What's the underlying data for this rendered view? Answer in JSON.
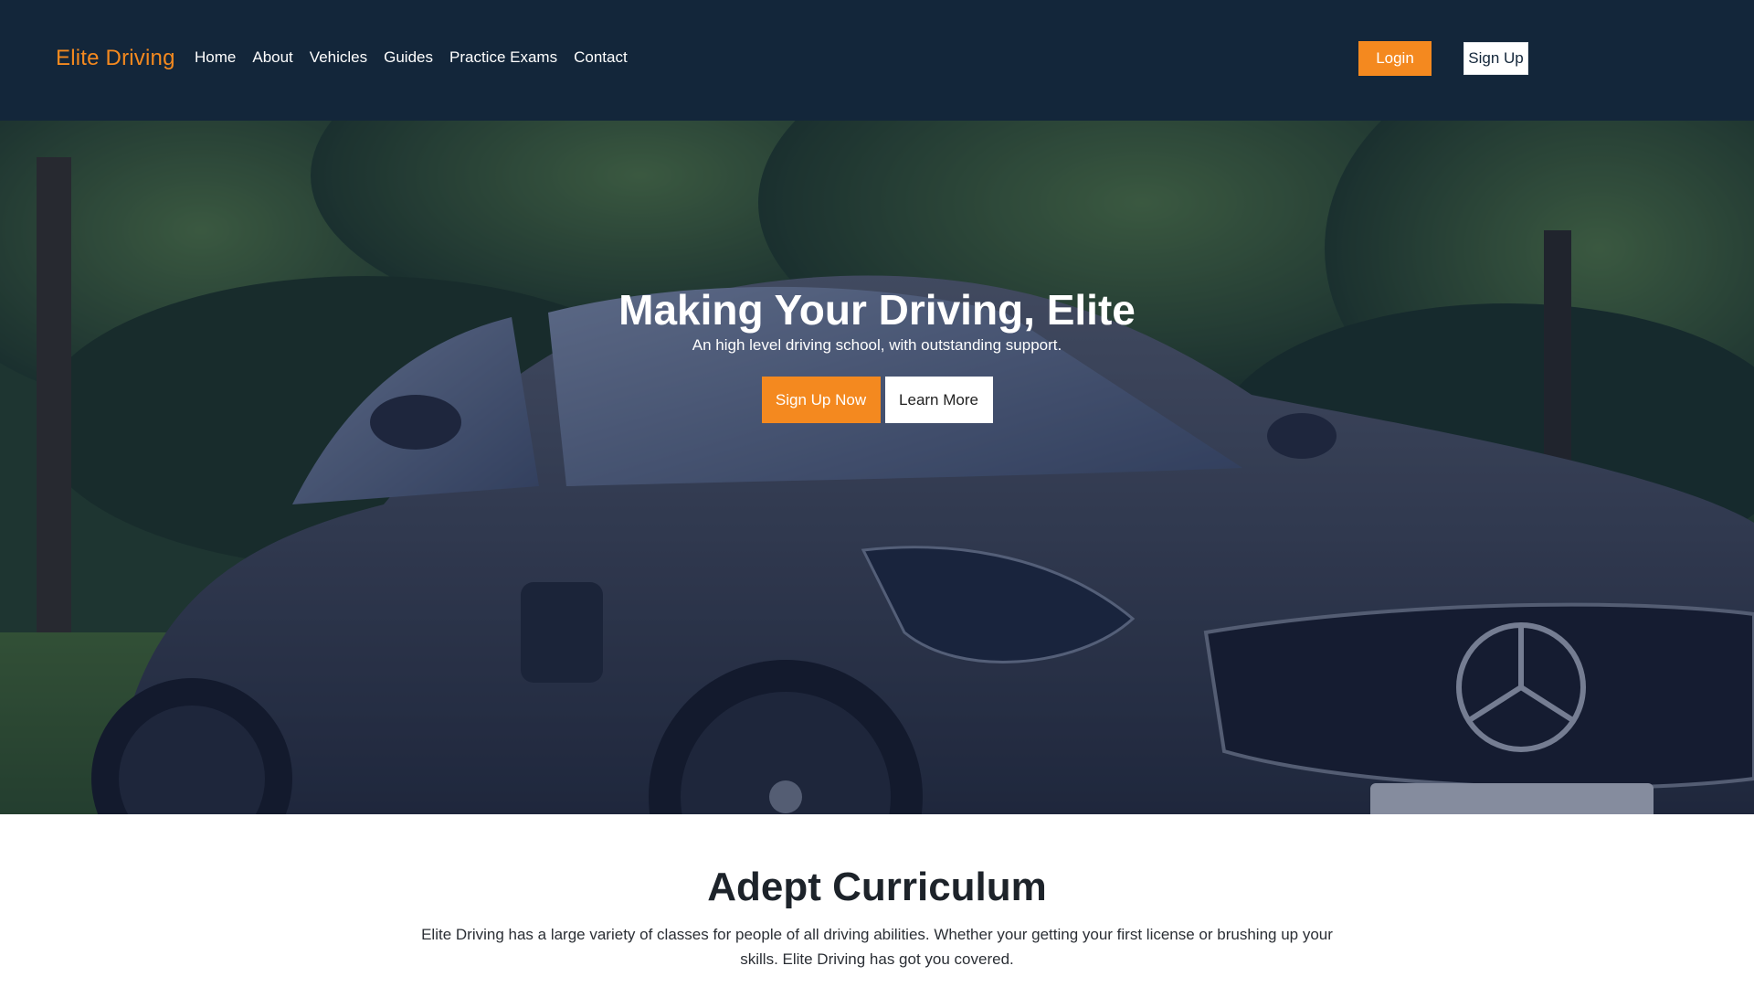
{
  "navbar": {
    "brand": "Elite Driving",
    "links": [
      "Home",
      "About",
      "Vehicles",
      "Guides",
      "Practice Exams",
      "Contact"
    ],
    "login_label": "Login",
    "signup_label": "Sign Up"
  },
  "hero": {
    "title": "Making Your Driving, Elite",
    "subtitle": "An high level driving school, with outstanding support.",
    "primary_button": "Sign Up Now",
    "secondary_button": "Learn More"
  },
  "curriculum": {
    "title": "Adept Curriculum",
    "text": "Elite Driving has a large variety of classes for people of all driving abilities. Whether your getting your first license or brushing up your skills. Elite Driving has got you covered."
  },
  "colors": {
    "navbar_bg": "#13263a",
    "accent": "#f4891f",
    "overlay": "#101c42"
  },
  "icons": {
    "hero_image": "sports-car-photo"
  }
}
